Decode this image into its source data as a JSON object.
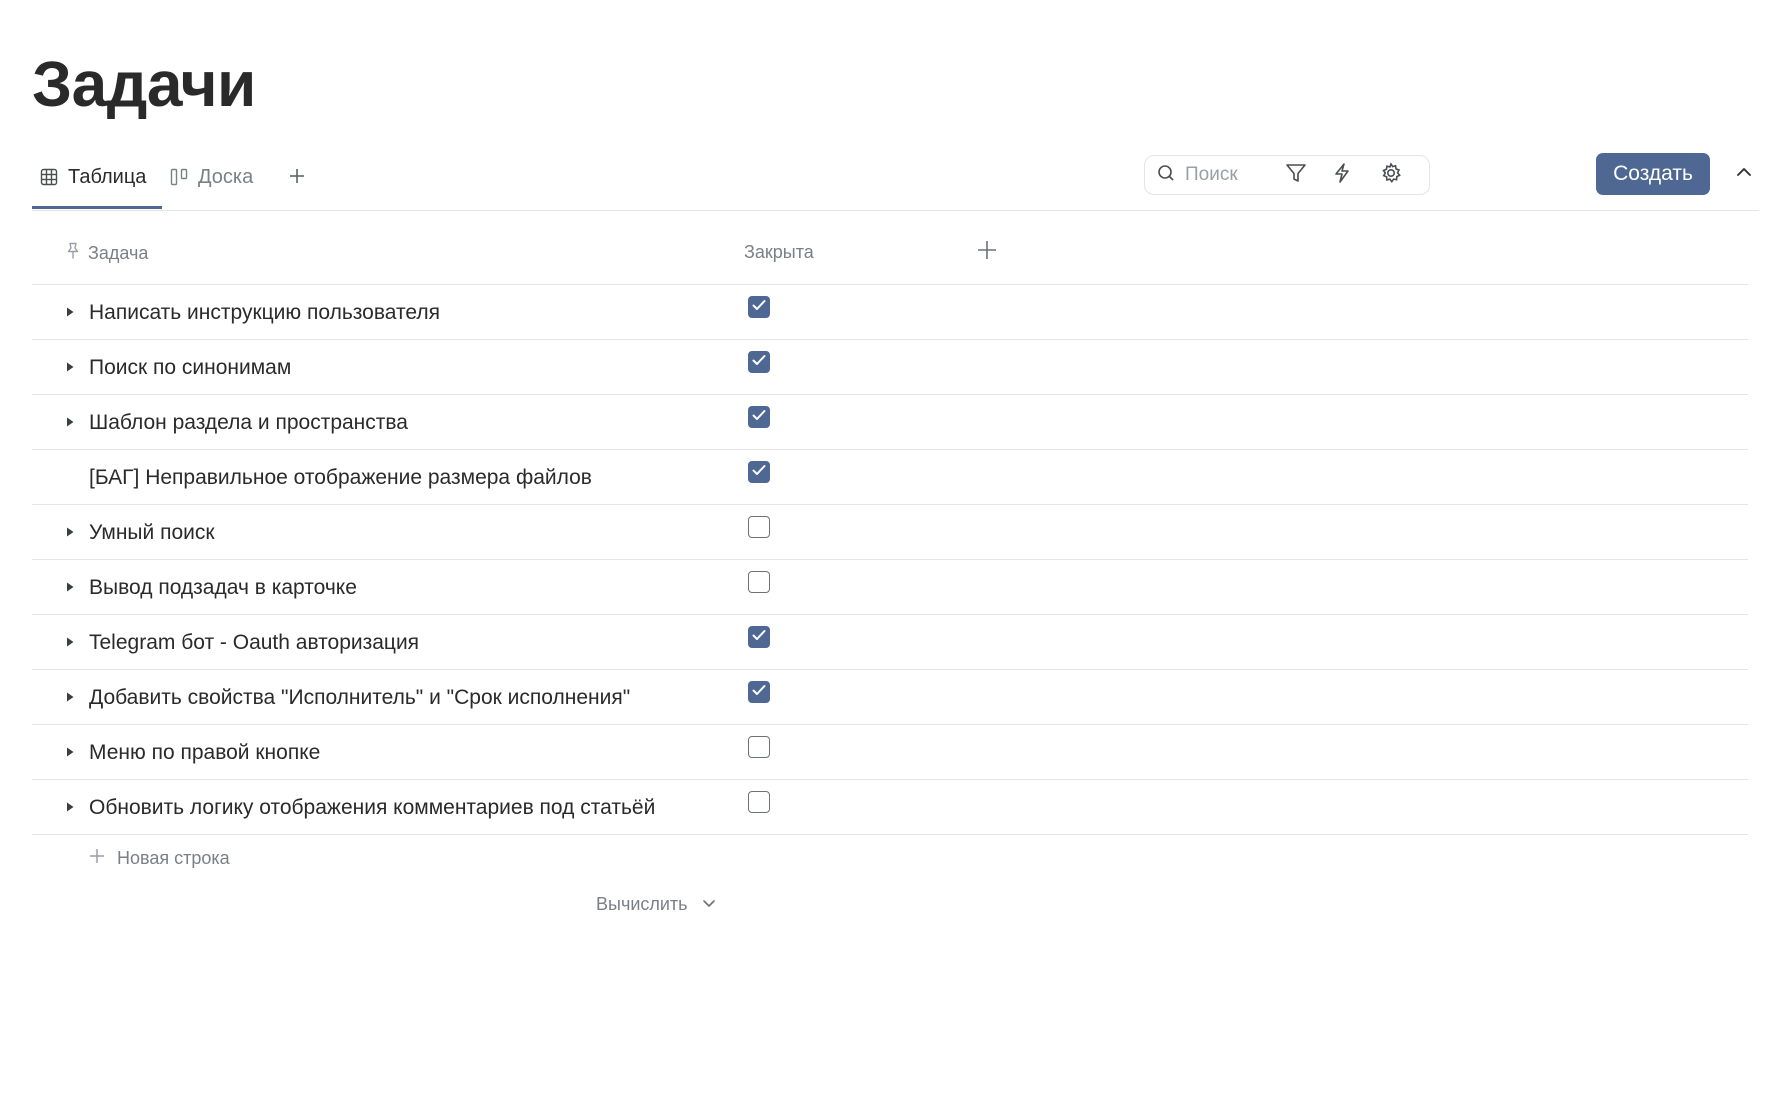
{
  "page": {
    "title": "Задачи"
  },
  "views": {
    "tabs": [
      {
        "label": "Таблица",
        "active": true,
        "icon": "table-icon"
      },
      {
        "label": "Доска",
        "active": false,
        "icon": "board-icon"
      }
    ],
    "add_view_icon": "plus-icon"
  },
  "toolbar": {
    "search_placeholder": "Поиск",
    "search_value": "",
    "filter_icon": "filter-icon",
    "automation_icon": "lightning-icon",
    "settings_icon": "gear-icon",
    "create_label": "Создать",
    "collapse_icon": "chevron-up-icon"
  },
  "table": {
    "columns": [
      {
        "label": "Задача",
        "icon": "pin-icon"
      },
      {
        "label": "Закрыта"
      }
    ],
    "add_column_icon": "plus-icon",
    "rows": [
      {
        "title": "Написать инструкцию пользователя",
        "closed": true,
        "has_children": true
      },
      {
        "title": "Поиск по синонимам",
        "closed": true,
        "has_children": true
      },
      {
        "title": "Шаблон раздела и пространства",
        "closed": true,
        "has_children": true
      },
      {
        "title": "[БАГ] Неправильное отображение размера файлов",
        "closed": true,
        "has_children": false
      },
      {
        "title": "Умный поиск",
        "closed": false,
        "has_children": true
      },
      {
        "title": "Вывод подзадач в карточке",
        "closed": false,
        "has_children": true
      },
      {
        "title": "Telegram бот - Oauth авторизация",
        "closed": true,
        "has_children": true
      },
      {
        "title": "Добавить свойства \"Исполнитель\" и \"Срок исполнения\"",
        "closed": true,
        "has_children": true
      },
      {
        "title": "Меню по правой кнопке",
        "closed": false,
        "has_children": true
      },
      {
        "title": "Обновить логику отображения комментариев под статьёй",
        "closed": false,
        "has_children": true
      }
    ],
    "new_row_label": "Новая строка",
    "compute_label": "Вычислить"
  },
  "colors": {
    "accent": "#4e6793",
    "text": "#2a2a2a",
    "muted": "#7b7f86",
    "border": "#e3e5e8"
  }
}
